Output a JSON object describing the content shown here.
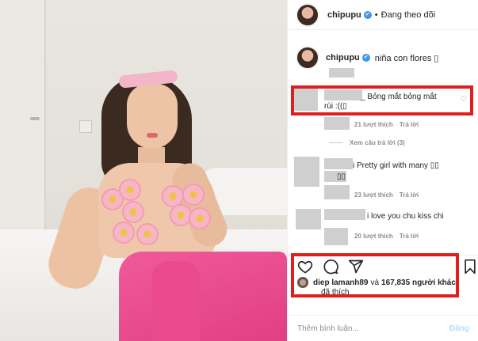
{
  "post": {
    "username": "chipupu",
    "verified_mark": "✔",
    "separator": "•",
    "follow_status": "Đang theo dõi"
  },
  "caption": {
    "username": "chipupu",
    "text": "niña con flores ▯"
  },
  "comments": [
    {
      "text_line1": "_ Bỏng mắt bỏng mắt",
      "text_line2": "rùi :((▯",
      "likes": "21 lượt thích",
      "reply_label": "Trả lời",
      "view_replies": "Xem câu trả lời (3)"
    },
    {
      "text_line1": "i Pretty girl with many ▯▯",
      "text_line2": "▯▯",
      "likes": "23 lượt thích",
      "reply_label": "Trả lời"
    },
    {
      "text_line1": "i love you chu kiss chi",
      "likes": "20 lượt thích",
      "reply_label": "Trả lời"
    }
  ],
  "likes_summary": {
    "user": "diep lamanh89",
    "connector": "và",
    "count_text": "167,835 người khác",
    "liked_label": "đã thích"
  },
  "add_comment": {
    "placeholder": "Thêm bình luận...",
    "post_label": "Đăng"
  },
  "icons": {
    "heart": "heart-icon",
    "comment": "comment-icon",
    "share": "share-icon",
    "bookmark": "bookmark-icon"
  },
  "colors": {
    "highlight_box": "#e01e1e",
    "verified": "#3897f0",
    "post_button_disabled": "#b2dffc"
  }
}
